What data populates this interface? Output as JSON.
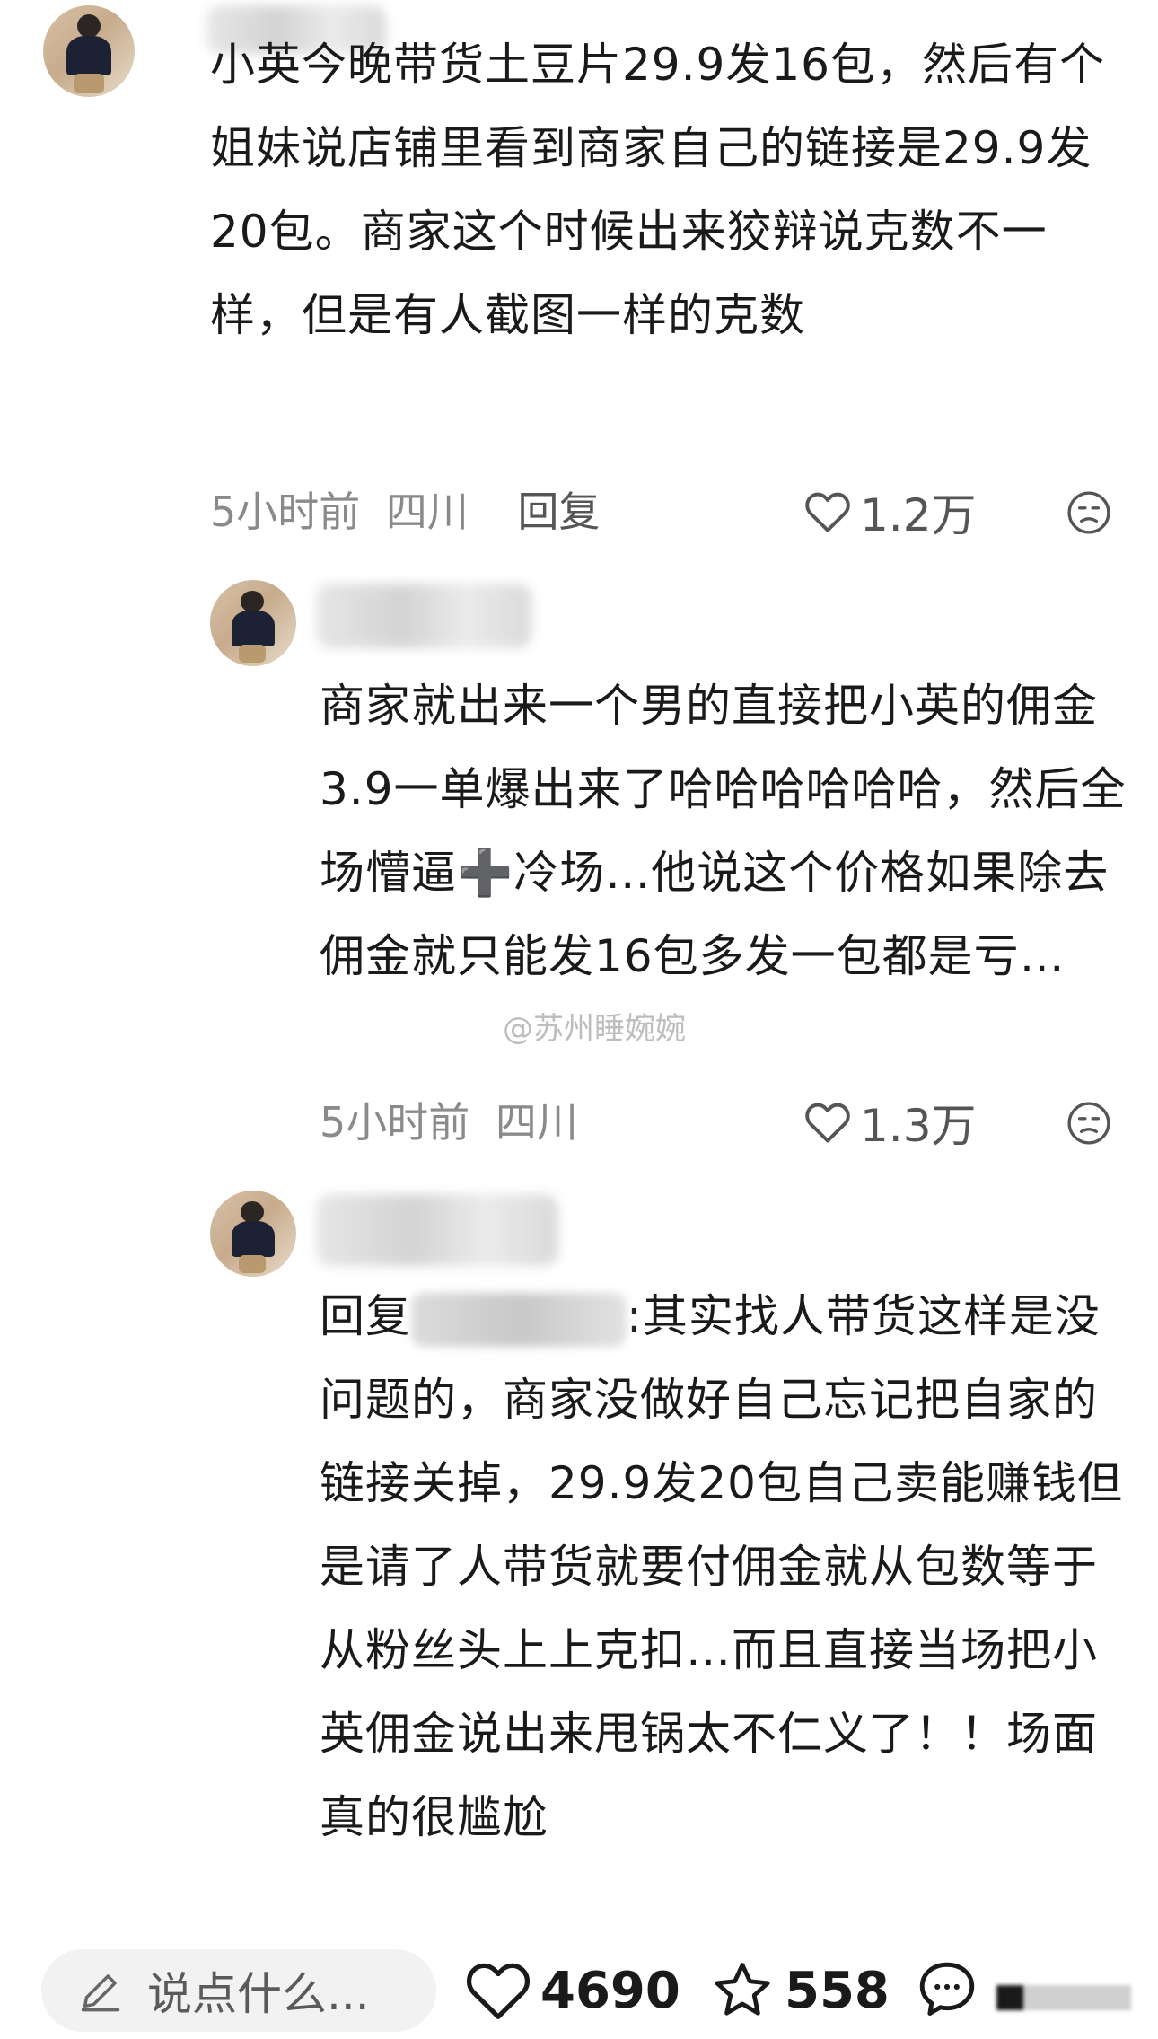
{
  "comments": [
    {
      "text": "小英今晚带货土豆片29.9发16包，然后有个姐妹说店铺里看到商家自己的链接是29.9发20包。商家这个时候出来狡辩说克数不一样，但是有人截图一样的克数",
      "time": "5小时前",
      "location": "四川",
      "reply_label": "回复",
      "likes": "1.2万"
    },
    {
      "text": "商家就出来一个男的直接把小英的佣金3.9一单爆出来了哈哈哈哈哈哈，然后全场懵逼➕冷场…他说这个价格如果除去佣金就只能发16包多发一包都是亏…",
      "time": "5小时前",
      "location": "四川",
      "likes": "1.3万"
    },
    {
      "reply_prefix": "回复",
      "text": ":其实找人带货这样是没问题的，商家没做好自己忘记把自家的链接关掉，29.9发20包自己卖能赚钱但是请了人带货就要付佣金就从包数等于从粉丝头上上克扣…而且直接当场把小英佣金说出来甩锅太不仁义了！！场面真的很尴尬"
    }
  ],
  "watermark": "@苏州睡婉婉",
  "bottom_bar": {
    "input_placeholder": "说点什么...",
    "likes": "4690",
    "favorites": "558"
  },
  "icons": [
    "heart-outline-icon",
    "sad-face-icon",
    "pencil-icon",
    "star-outline-icon",
    "chat-bubble-icon"
  ]
}
